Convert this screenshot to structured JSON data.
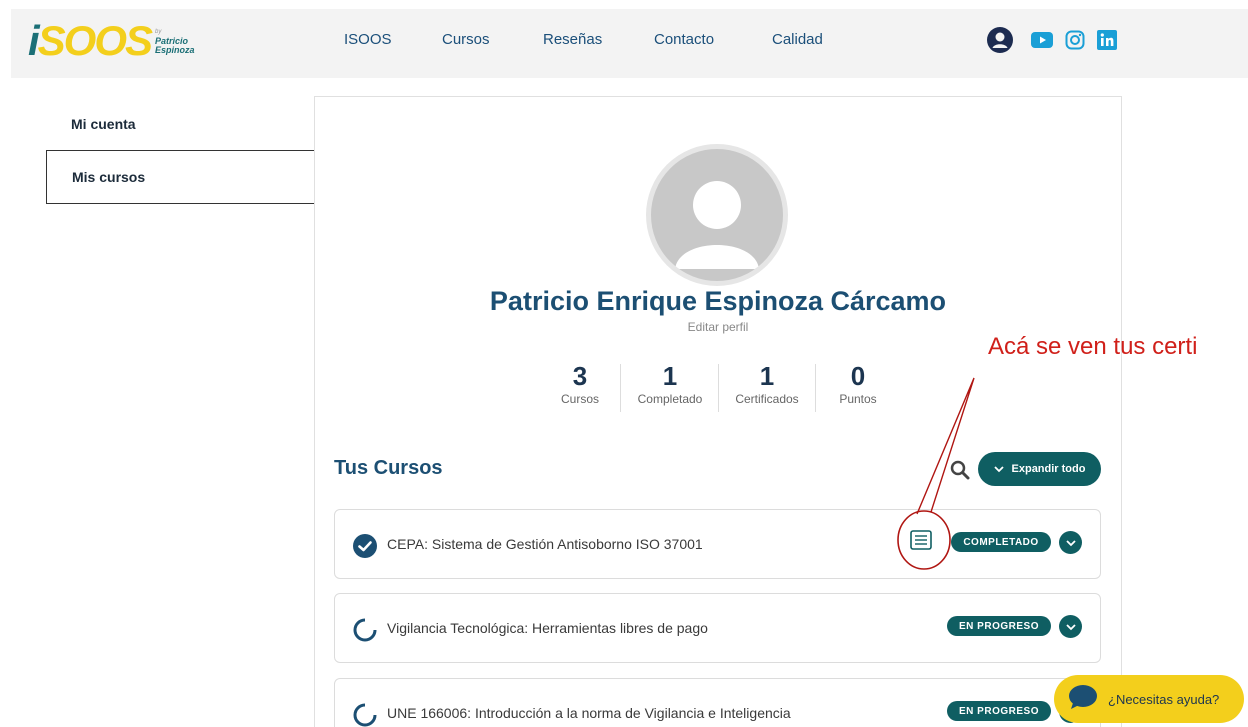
{
  "header": {
    "logo": {
      "main_i": "i",
      "main_rest": "SOOS",
      "by": "by",
      "name1": "Patricio",
      "name2": "Espinoza"
    },
    "nav": [
      "ISOOS",
      "Cursos",
      "Reseñas",
      "Contacto",
      "Calidad"
    ],
    "icons": [
      "user-icon",
      "youtube-icon",
      "instagram-icon",
      "linkedin-icon"
    ]
  },
  "sidebar": {
    "items": [
      {
        "label": "Mi cuenta",
        "active": false
      },
      {
        "label": "Mis cursos",
        "active": true
      }
    ]
  },
  "profile": {
    "name": "Patricio Enrique Espinoza Cárcamo",
    "edit_label": "Editar perfil",
    "stats": [
      {
        "value": "3",
        "label": "Cursos"
      },
      {
        "value": "1",
        "label": "Completado"
      },
      {
        "value": "1",
        "label": "Certificados"
      },
      {
        "value": "0",
        "label": "Puntos"
      }
    ]
  },
  "courses": {
    "heading": "Tus Cursos",
    "expand_label": "Expandir todo",
    "items": [
      {
        "title": "CEPA: Sistema de Gestión Antisoborno ISO 37001",
        "status": "COMPLETADO",
        "completed": true
      },
      {
        "title": "Vigilancia Tecnológica: Herramientas libres de pago",
        "status": "EN PROGRESO",
        "completed": false
      },
      {
        "title": "UNE 166006: Introducción a la norma de Vigilancia e Inteligencia",
        "status": "EN PROGRESO",
        "completed": false
      }
    ]
  },
  "annotation": {
    "text": "Acá se ven tus certi"
  },
  "help": {
    "label": "¿Necesitas ayuda?"
  },
  "colors": {
    "primary": "#0f5e62",
    "accent": "#f3cf1c",
    "annotation": "#d0201a",
    "heading": "#1c4f73"
  }
}
